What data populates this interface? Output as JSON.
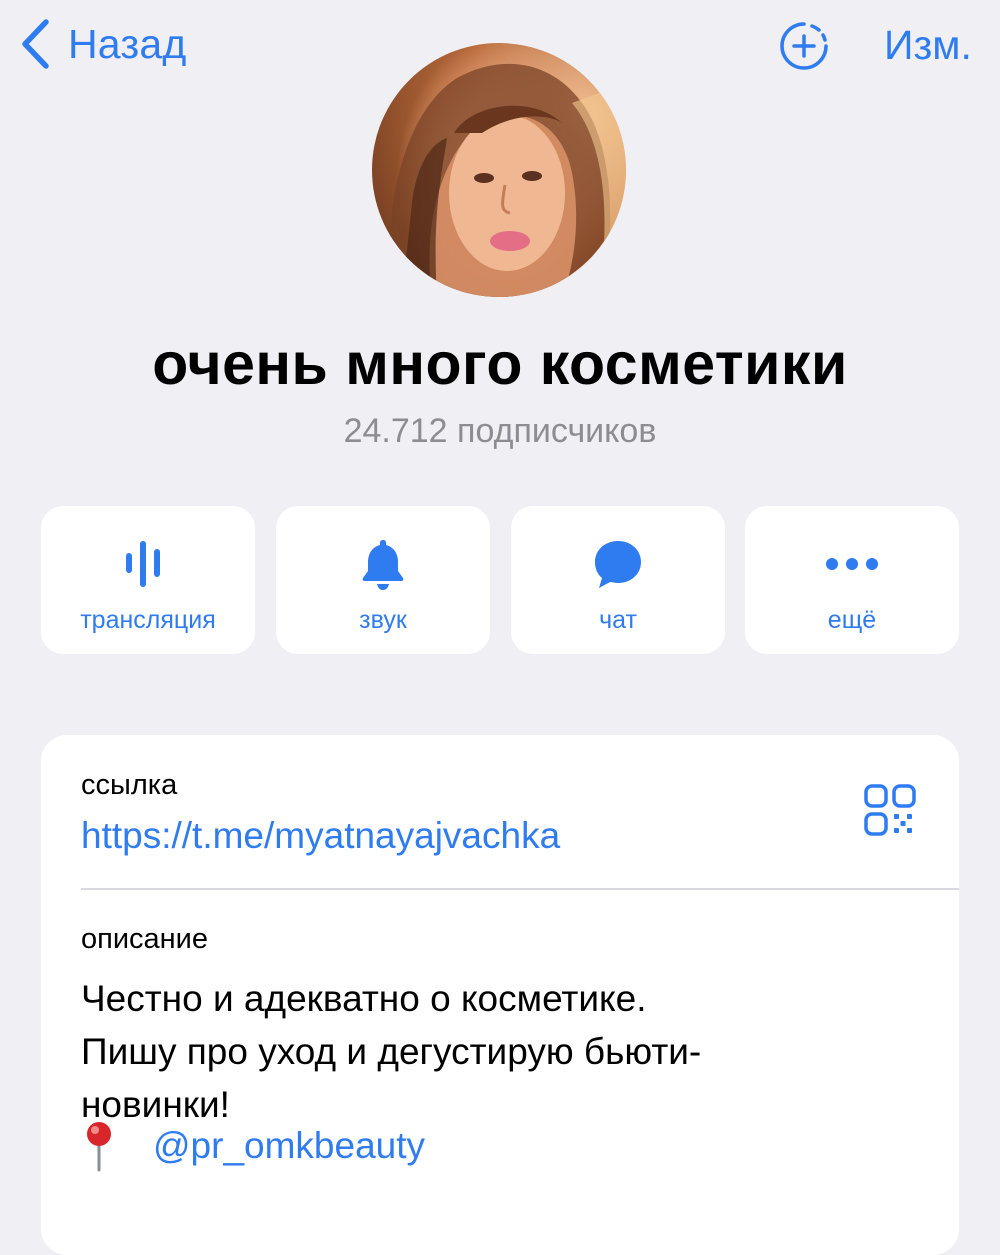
{
  "nav": {
    "back_label": "Назад",
    "edit_label": "Изм.",
    "accent_color": "#2f7bf0"
  },
  "channel": {
    "title": "очень много косметики",
    "subscribers": "24.712 подписчиков"
  },
  "actions": [
    {
      "icon": "broadcast-icon",
      "label": "трансляция"
    },
    {
      "icon": "bell-icon",
      "label": "звук"
    },
    {
      "icon": "chat-bubble-icon",
      "label": "чат"
    },
    {
      "icon": "more-dots-icon",
      "label": "ещё"
    }
  ],
  "info": {
    "link_label": "ссылка",
    "link_value": "https://t.me/myatnayajvachka",
    "description_label": "описание",
    "description_lines": [
      "Честно и адекватно о косметике.",
      "Пишу про уход и дегустирую бьюти-",
      "новинки!"
    ],
    "handle": "@pr_omkbeauty"
  }
}
